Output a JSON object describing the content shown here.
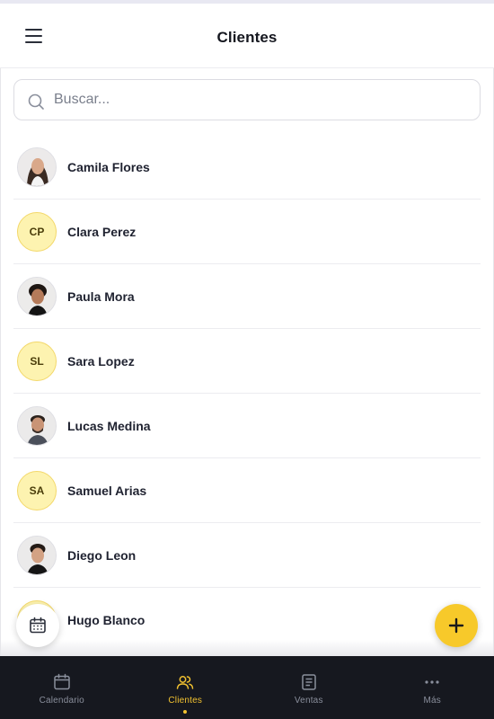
{
  "header": {
    "title": "Clientes",
    "menu_icon": "hamburger-menu-icon"
  },
  "search": {
    "placeholder": "Buscar...",
    "value": "",
    "icon": "search-icon"
  },
  "clients": [
    {
      "name": "Camila Flores",
      "avatar_type": "photo",
      "initials": ""
    },
    {
      "name": "Clara Perez",
      "avatar_type": "initials",
      "initials": "CP"
    },
    {
      "name": "Paula Mora",
      "avatar_type": "photo",
      "initials": ""
    },
    {
      "name": "Sara Lopez",
      "avatar_type": "initials",
      "initials": "SL"
    },
    {
      "name": "Lucas Medina",
      "avatar_type": "photo",
      "initials": ""
    },
    {
      "name": "Samuel Arias",
      "avatar_type": "initials",
      "initials": "SA"
    },
    {
      "name": "Diego Leon",
      "avatar_type": "photo",
      "initials": ""
    },
    {
      "name": "Hugo Blanco",
      "avatar_type": "initials",
      "initials": ""
    }
  ],
  "fabs": {
    "calendar_icon": "calendar-icon",
    "add_icon": "plus-icon"
  },
  "bottom_nav": {
    "items": [
      {
        "label": "Calendario",
        "icon": "calendar-icon",
        "active": false
      },
      {
        "label": "Clientes",
        "icon": "users-icon",
        "active": true
      },
      {
        "label": "Ventas",
        "icon": "receipt-icon",
        "active": false
      },
      {
        "label": "Más",
        "icon": "more-dots-icon",
        "active": false
      }
    ]
  },
  "colors": {
    "accent": "#f7c92a",
    "nav_background": "#16181f",
    "nav_active": "#f2c230",
    "initials_background": "#fdf3b0"
  }
}
